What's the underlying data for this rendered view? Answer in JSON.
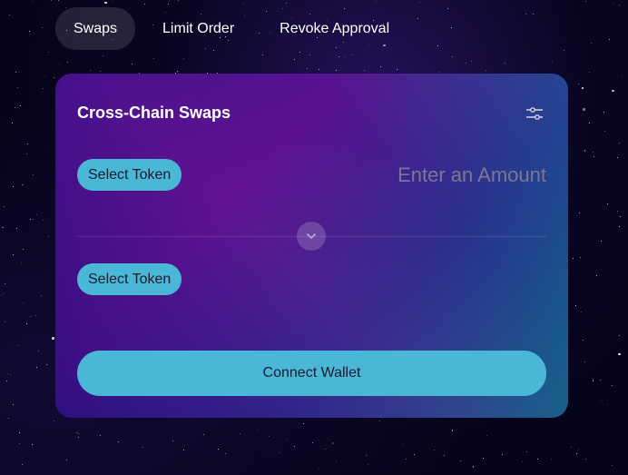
{
  "nav": {
    "tabs": [
      {
        "label": "Swaps",
        "active": true
      },
      {
        "label": "Limit Order",
        "active": false
      },
      {
        "label": "Revoke Approval",
        "active": false
      }
    ]
  },
  "swap_card": {
    "title": "Cross-Chain Swaps",
    "settings_icon": "sliders-icon",
    "from": {
      "token_button_label": "Select Token",
      "amount_placeholder": "Enter an Amount",
      "amount_value": ""
    },
    "swap_direction_icon": "chevron-down-icon",
    "to": {
      "token_button_label": "Select Token"
    },
    "connect_button_label": "Connect Wallet"
  },
  "colors": {
    "accent": "#4bb7d6",
    "card_gradient_start": "#3a0f8a",
    "card_gradient_end": "#0e6a8a",
    "background": "#06041a"
  }
}
